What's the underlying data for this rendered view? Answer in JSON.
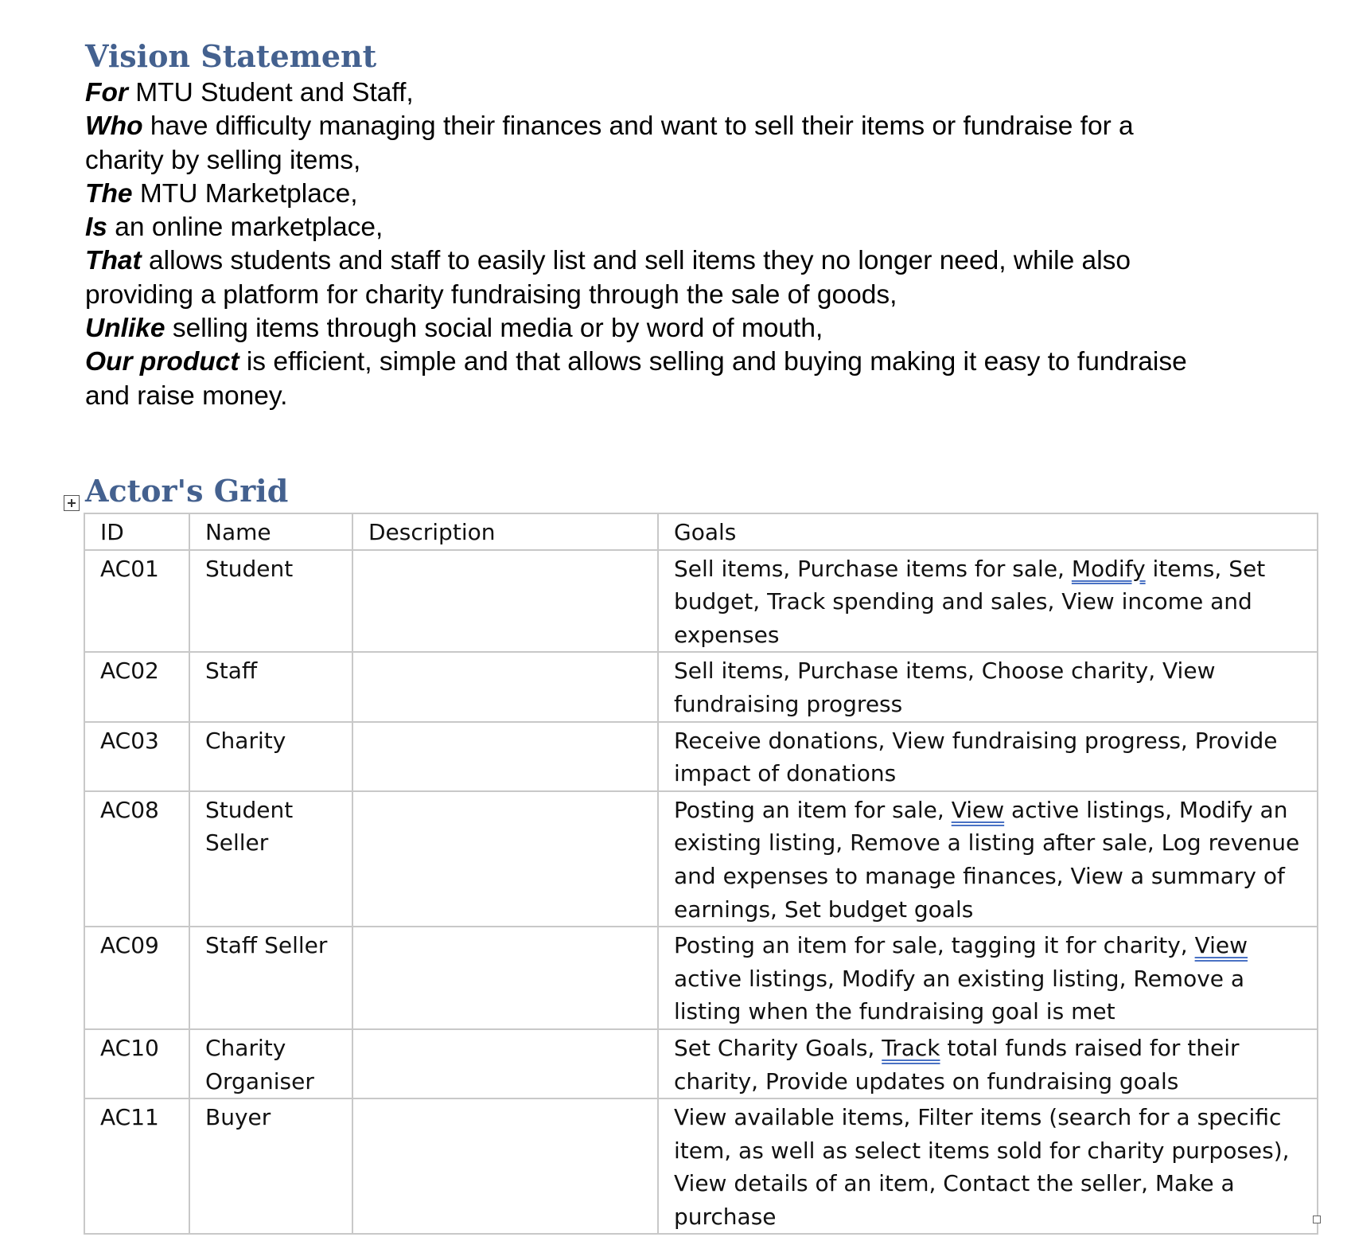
{
  "vision_section": {
    "heading": "Vision Statement",
    "lines": [
      [
        "For",
        " MTU Student and Staff,"
      ],
      [
        "Who",
        " have difficulty managing their finances and want to sell their items or fundraise for a"
      ],
      [
        "",
        "charity by selling items,"
      ],
      [
        "The",
        " MTU Marketplace,"
      ],
      [
        "Is",
        " an online marketplace,"
      ],
      [
        "That",
        " allows students and staff to easily list and sell items they no longer need, while also"
      ],
      [
        "",
        "providing a platform for charity fundraising through the sale of goods,"
      ],
      [
        "Unlike",
        " selling items through social media or by word of mouth,"
      ],
      [
        "Our product",
        " is efficient, simple and that allows selling and buying making it easy to fundraise"
      ],
      [
        "",
        "and raise money."
      ]
    ]
  },
  "actors_section": {
    "heading": "Actor's Grid",
    "columns": [
      "ID",
      "Name",
      "Description",
      "Goals"
    ],
    "rows": [
      {
        "id": "AC01",
        "name": "Student",
        "description": "",
        "goals": [
          "Sell items, Purchase items for sale, ",
          "Modify",
          " items, Set budget, Track spending and sales, View income and expenses"
        ]
      },
      {
        "id": "AC02",
        "name": "Staff",
        "description": "",
        "goals": [
          "Sell items, Purchase items, Choose charity, View fundraising progress",
          "",
          ""
        ]
      },
      {
        "id": "AC03",
        "name": "Charity",
        "description": "",
        "goals": [
          "Receive donations, View fundraising progress, Provide impact of donations",
          "",
          ""
        ]
      },
      {
        "id": "AC08",
        "name": "Student Seller",
        "description": "",
        "goals": [
          "Posting an item for sale, ",
          "View",
          " active listings, Modify an existing listing, Remove a listing after sale, Log revenue and expenses to manage finances, View a summary of earnings, Set budget goals"
        ]
      },
      {
        "id": "AC09",
        "name": "Staff Seller",
        "description": "",
        "goals": [
          "Posting an item for sale, tagging it for charity, ",
          "View",
          " active listings, Modify an existing listing, Remove a listing when the fundraising goal is met"
        ]
      },
      {
        "id": "AC10",
        "name": "Charity Organiser",
        "description": "",
        "goals": [
          "Set Charity Goals, ",
          "Track",
          " total funds raised for their charity, Provide updates on fundraising goals"
        ]
      },
      {
        "id": "AC11",
        "name": "Buyer",
        "description": "",
        "goals": [
          "View available items, Filter items (search for a specific item, as well as select items sold for charity purposes), View details of an item, Contact the seller, Make a purchase",
          "",
          ""
        ]
      }
    ]
  }
}
